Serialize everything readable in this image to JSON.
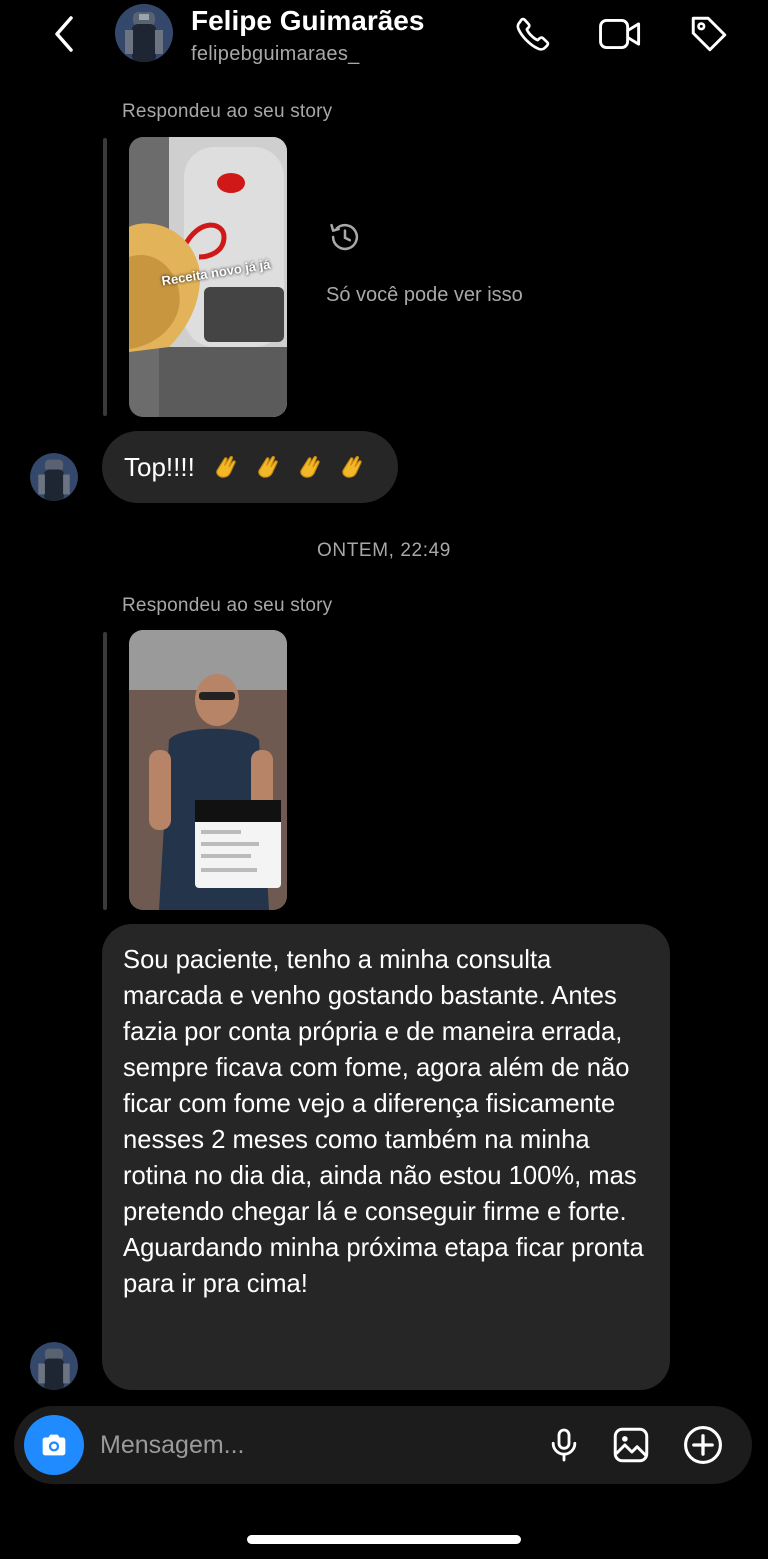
{
  "header": {
    "name": "Felipe Guimarães",
    "username": "felipebguimaraes_"
  },
  "messages": {
    "reply1_label": "Respondeu ao seu story",
    "story1_overlay": "Receita novo já já",
    "private_note": "Só você pode ver isso",
    "top_text": "Top!!!!",
    "timestamp": "ONTEM, 22:49",
    "reply2_label": "Respondeu ao seu story",
    "long_text": "Sou paciente, tenho a minha consulta marcada e venho gostando bastante. Antes fazia por conta própria e de maneira errada, sempre ficava com fome, agora além de não ficar com fome vejo a diferença fisicamente nesses 2 meses como também na minha rotina no dia dia, ainda não estou 100%, mas pretendo chegar lá e conseguir firme e forte. Aguardando minha próxima etapa ficar pronta para ir pra cima!"
  },
  "composer": {
    "placeholder": "Mensagem..."
  },
  "colors": {
    "background": "#000000",
    "bubble": "#262626",
    "accent_blue": "#1f8bff",
    "secondary_text": "#a8a8a8"
  },
  "icons": [
    "back-chevron-icon",
    "phone-icon",
    "video-icon",
    "tag-icon",
    "history-icon",
    "camera-icon",
    "microphone-icon",
    "gallery-icon",
    "plus-icon"
  ]
}
